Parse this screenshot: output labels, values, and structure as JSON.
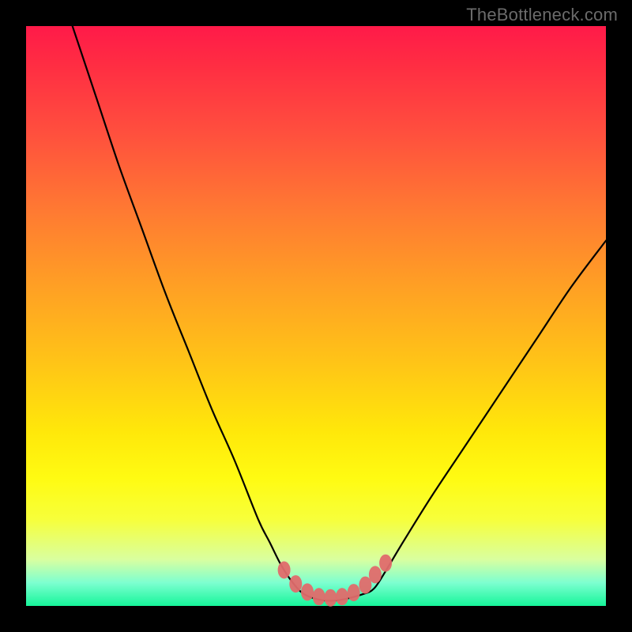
{
  "watermark": "TheBottleneck.com",
  "chart_data": {
    "type": "line",
    "title": "",
    "xlabel": "",
    "ylabel": "",
    "xlim": [
      0,
      100
    ],
    "ylim": [
      0,
      100
    ],
    "series": [
      {
        "name": "bottleneck-curve",
        "x": [
          8,
          12,
          16,
          20,
          24,
          28,
          32,
          36,
          40,
          42,
          44,
          46,
          48,
          51,
          54,
          58,
          60,
          62,
          65,
          70,
          76,
          82,
          88,
          94,
          100
        ],
        "y": [
          100,
          88,
          76,
          65,
          54,
          44,
          34,
          25,
          15,
          11,
          7,
          4,
          2,
          1,
          1,
          2,
          3,
          6,
          11,
          19,
          28,
          37,
          46,
          55,
          63
        ]
      }
    ],
    "markers": {
      "name": "sample-points",
      "color": "#e06b6b",
      "x": [
        44.5,
        46.5,
        48.5,
        50.5,
        52.5,
        54.5,
        56.5,
        58.5,
        60.2,
        62.0
      ],
      "y": [
        6.2,
        3.8,
        2.4,
        1.6,
        1.4,
        1.6,
        2.3,
        3.6,
        5.4,
        7.4
      ]
    },
    "gradient_stops": [
      {
        "pos": 0.0,
        "color": "#ff1a49"
      },
      {
        "pos": 0.32,
        "color": "#ff7a32"
      },
      {
        "pos": 0.7,
        "color": "#ffe80a"
      },
      {
        "pos": 0.92,
        "color": "#d9ffa0"
      },
      {
        "pos": 1.0,
        "color": "#16f59a"
      }
    ]
  }
}
